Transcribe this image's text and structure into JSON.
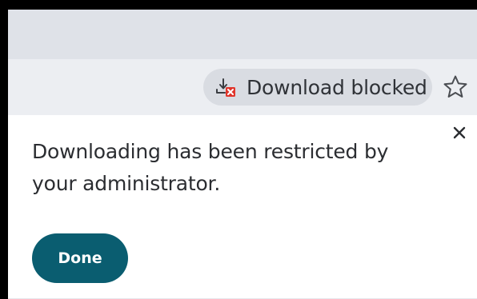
{
  "toolbar": {
    "download_chip": {
      "label": "Download blocked",
      "icon": "download-blocked-icon"
    },
    "star_icon": "star-outline-icon"
  },
  "bubble": {
    "message": "Downloading has been restricted by your administrator.",
    "done_label": "Done",
    "close_icon": "close-icon"
  },
  "colors": {
    "tabstrip_bg": "#dfe2e8",
    "toolbar_bg": "#eceef2",
    "chip_bg": "#d9dce2",
    "done_bg": "#0a5d70",
    "blocked_red": "#e0352b"
  }
}
